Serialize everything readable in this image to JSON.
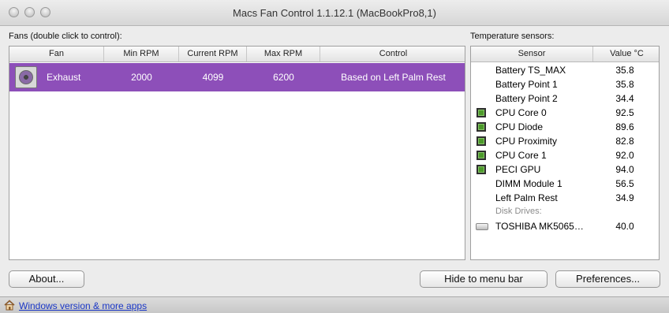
{
  "window": {
    "title": "Macs Fan Control 1.1.12.1 (MacBookPro8,1)"
  },
  "fans": {
    "label": "Fans (double click to control):",
    "columns": {
      "fan": "Fan",
      "min": "Min RPM",
      "current": "Current RPM",
      "max": "Max RPM",
      "control": "Control"
    },
    "rows": [
      {
        "name": "Exhaust",
        "min": "2000",
        "current": "4099",
        "max": "6200",
        "control": "Based on Left Palm Rest",
        "selected": true
      }
    ]
  },
  "sensors": {
    "label": "Temperature sensors:",
    "columns": {
      "sensor": "Sensor",
      "value": "Value °C"
    },
    "rows": [
      {
        "name": "Battery TS_MAX",
        "value": "35.8",
        "icon": "none"
      },
      {
        "name": "Battery Point 1",
        "value": "35.8",
        "icon": "none"
      },
      {
        "name": "Battery Point 2",
        "value": "34.4",
        "icon": "none"
      },
      {
        "name": "CPU Core 0",
        "value": "92.5",
        "icon": "chip"
      },
      {
        "name": "CPU Diode",
        "value": "89.6",
        "icon": "chip"
      },
      {
        "name": "CPU Proximity",
        "value": "82.8",
        "icon": "chip"
      },
      {
        "name": "CPU Core 1",
        "value": "92.0",
        "icon": "chip"
      },
      {
        "name": "PECI GPU",
        "value": "94.0",
        "icon": "chip"
      },
      {
        "name": "DIMM Module 1",
        "value": "56.5",
        "icon": "none"
      },
      {
        "name": "Left Palm Rest",
        "value": "34.9",
        "icon": "none"
      }
    ],
    "disk_group_label": "Disk Drives:",
    "disk_rows": [
      {
        "name": "TOSHIBA MK5065…",
        "value": "40.0",
        "icon": "disk"
      }
    ]
  },
  "buttons": {
    "about": "About...",
    "hide": "Hide to menu bar",
    "preferences": "Preferences..."
  },
  "footer": {
    "link": "Windows version & more apps"
  },
  "colors": {
    "selection": "#8d4fb9",
    "link": "#1a37c7",
    "chip": "#4c9a2a"
  }
}
